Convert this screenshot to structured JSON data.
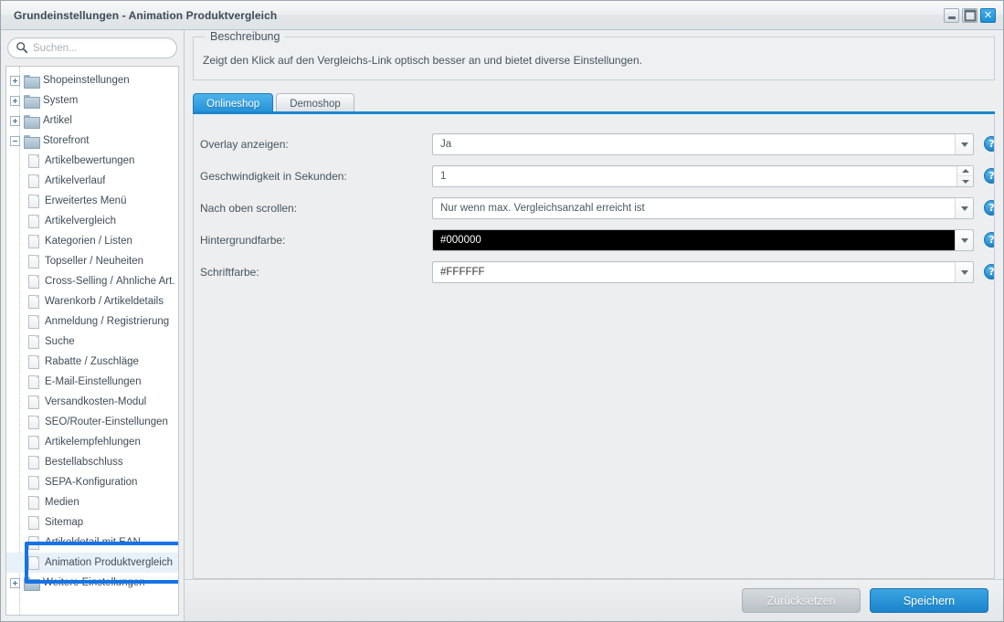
{
  "window": {
    "title": "Grundeinstellungen - Animation Produktvergleich",
    "minimize_label": "Minimieren",
    "maximize_label": "Maximieren",
    "close_label": "✕"
  },
  "sidebar": {
    "search": {
      "placeholder": "Suchen...",
      "value": "",
      "icon": "search-icon"
    },
    "tree": [
      {
        "label": "Shopeinstellungen",
        "type": "folder",
        "expander": "plus",
        "level": 0,
        "selected": false
      },
      {
        "label": "System",
        "type": "folder",
        "expander": "plus",
        "level": 0,
        "selected": false
      },
      {
        "label": "Artikel",
        "type": "folder",
        "expander": "plus",
        "level": 0,
        "selected": false
      },
      {
        "label": "Storefront",
        "type": "folder",
        "expander": "minus",
        "level": 0,
        "selected": false
      },
      {
        "label": "Artikelbewertungen",
        "type": "page",
        "expander": "none",
        "level": 1,
        "selected": false
      },
      {
        "label": "Artikelverlauf",
        "type": "page",
        "expander": "none",
        "level": 1,
        "selected": false
      },
      {
        "label": "Erweitertes Menü",
        "type": "page",
        "expander": "none",
        "level": 1,
        "selected": false
      },
      {
        "label": "Artikelvergleich",
        "type": "page",
        "expander": "none",
        "level": 1,
        "selected": false
      },
      {
        "label": "Kategorien / Listen",
        "type": "page",
        "expander": "none",
        "level": 1,
        "selected": false
      },
      {
        "label": "Topseller / Neuheiten",
        "type": "page",
        "expander": "none",
        "level": 1,
        "selected": false
      },
      {
        "label": "Cross-Selling / Ähnliche Art.",
        "type": "page",
        "expander": "none",
        "level": 1,
        "selected": false
      },
      {
        "label": "Warenkorb / Artikeldetails",
        "type": "page",
        "expander": "none",
        "level": 1,
        "selected": false
      },
      {
        "label": "Anmeldung / Registrierung",
        "type": "page",
        "expander": "none",
        "level": 1,
        "selected": false
      },
      {
        "label": "Suche",
        "type": "page",
        "expander": "none",
        "level": 1,
        "selected": false
      },
      {
        "label": "Rabatte / Zuschläge",
        "type": "page",
        "expander": "none",
        "level": 1,
        "selected": false
      },
      {
        "label": "E-Mail-Einstellungen",
        "type": "page",
        "expander": "none",
        "level": 1,
        "selected": false
      },
      {
        "label": "Versandkosten-Modul",
        "type": "page",
        "expander": "none",
        "level": 1,
        "selected": false
      },
      {
        "label": "SEO/Router-Einstellungen",
        "type": "page",
        "expander": "none",
        "level": 1,
        "selected": false
      },
      {
        "label": "Artikelempfehlungen",
        "type": "page",
        "expander": "none",
        "level": 1,
        "selected": false
      },
      {
        "label": "Bestellabschluss",
        "type": "page",
        "expander": "none",
        "level": 1,
        "selected": false
      },
      {
        "label": "SEPA-Konfiguration",
        "type": "page",
        "expander": "none",
        "level": 1,
        "selected": false
      },
      {
        "label": "Medien",
        "type": "page",
        "expander": "none",
        "level": 1,
        "selected": false
      },
      {
        "label": "Sitemap",
        "type": "page",
        "expander": "none",
        "level": 1,
        "selected": false
      },
      {
        "label": "Artikeldetail mit EAN",
        "type": "page",
        "expander": "none",
        "level": 1,
        "selected": false
      },
      {
        "label": "Animation Produktvergleich",
        "type": "page",
        "expander": "none",
        "level": 1,
        "selected": true
      },
      {
        "label": "Weitere Einstellungen",
        "type": "folder",
        "expander": "plus",
        "level": 0,
        "selected": false
      }
    ],
    "highlight": {
      "target": "Animation Produktvergleich",
      "color": "#1473e6"
    }
  },
  "main": {
    "description": {
      "legend": "Beschreibung",
      "text": "Zeigt den Klick auf den Vergleichs-Link optisch besser an und bietet diverse Einstellungen."
    },
    "tabs": [
      {
        "label": "Onlineshop",
        "active": true
      },
      {
        "label": "Demoshop",
        "active": false
      }
    ],
    "fields": [
      {
        "label": "Overlay anzeigen:",
        "control": "select",
        "value": "Ja",
        "help": "?"
      },
      {
        "label": "Geschwindigkeit in Sekunden:",
        "control": "spinner",
        "value": "1",
        "help": "?"
      },
      {
        "label": "Nach oben scrollen:",
        "control": "select",
        "value": "Nur wenn max. Vergleichsanzahl erreicht ist",
        "help": "?"
      },
      {
        "label": "Hintergrundfarbe:",
        "control": "color",
        "value": "#000000",
        "swatch_bg": "#000000",
        "swatch_fg": "#FFFFFF",
        "help": "?"
      },
      {
        "label": "Schriftfarbe:",
        "control": "color",
        "value": "#FFFFFF",
        "swatch_bg": "#FFFFFF",
        "swatch_fg": "#333333",
        "help": "?"
      }
    ]
  },
  "footer": {
    "reset_label": "Zurücksetzen",
    "save_label": "Speichern"
  }
}
